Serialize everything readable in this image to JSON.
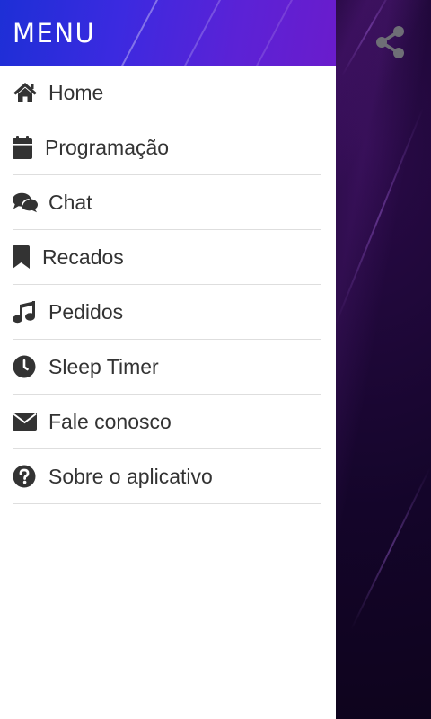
{
  "drawer": {
    "title": "MENU",
    "items": [
      {
        "label": "Home",
        "icon": "home-icon"
      },
      {
        "label": "Programação",
        "icon": "calendar-icon"
      },
      {
        "label": "Chat",
        "icon": "chat-icon"
      },
      {
        "label": "Recados",
        "icon": "bookmark-icon"
      },
      {
        "label": "Pedidos",
        "icon": "music-note-icon"
      },
      {
        "label": "Sleep Timer",
        "icon": "clock-icon"
      },
      {
        "label": "Fale conosco",
        "icon": "envelope-icon"
      },
      {
        "label": "Sobre o aplicativo",
        "icon": "question-circle-icon"
      }
    ]
  },
  "toolbar": {
    "share_icon": "share-icon"
  },
  "colors": {
    "header_gradient_start": "#1d2fd6",
    "header_gradient_end": "#6a1ccc",
    "menu_text": "#333333",
    "divider": "#dedede",
    "background": "#0d0418",
    "share_icon": "#6e6e76"
  }
}
